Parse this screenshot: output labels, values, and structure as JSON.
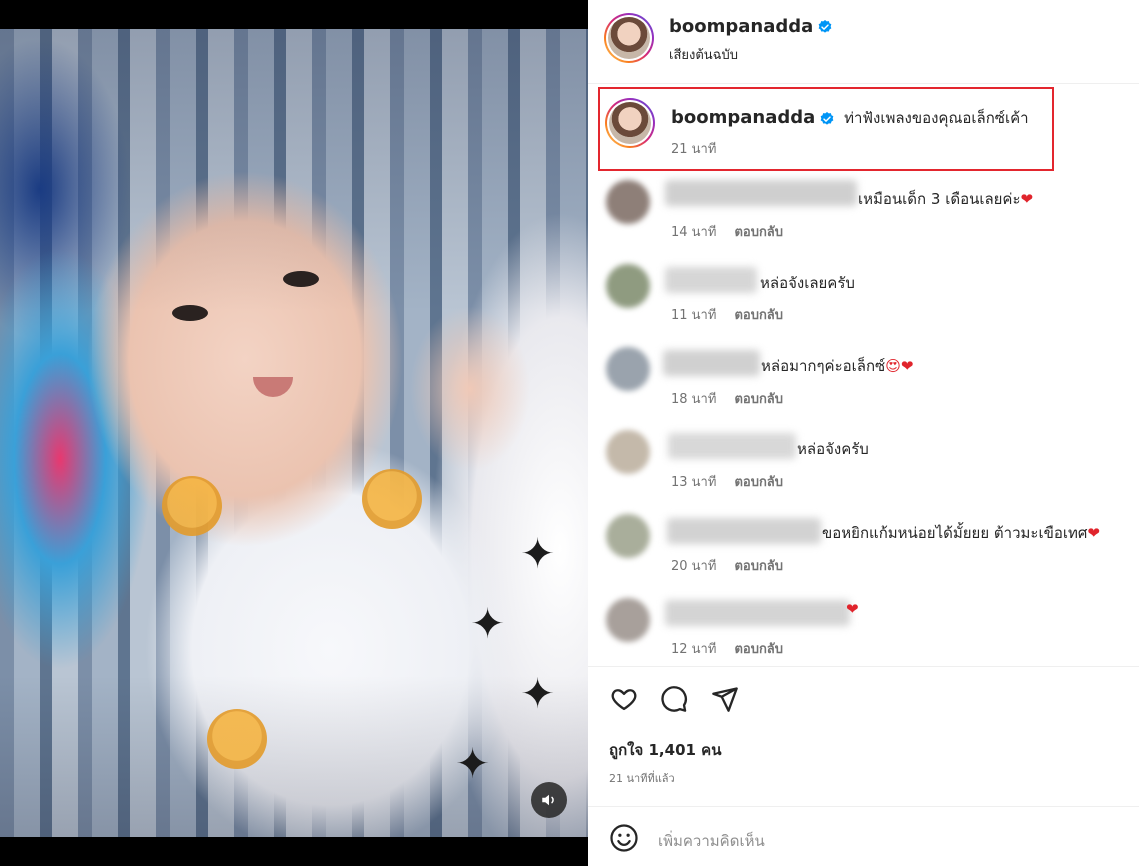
{
  "post": {
    "username": "boompanadda",
    "audio_label": "เสียงต้นฉบับ"
  },
  "caption": {
    "username": "boompanadda",
    "text": "ท่าฟังเพลงของคุณอเล็กซ์เค้า",
    "time": "21 นาที"
  },
  "comments": [
    {
      "text": "เหมือนเด็ก 3 เดือนเลยค่ะ",
      "emoji": "❤",
      "time": "14 นาที",
      "reply": "ตอบกลับ"
    },
    {
      "text": "หล่อจังเลยครับ",
      "emoji": "",
      "time": "11 นาที",
      "reply": "ตอบกลับ"
    },
    {
      "text": "หล่อมากๆค่ะอเล็กซ์",
      "emoji": "😍❤",
      "time": "18 นาที",
      "reply": "ตอบกลับ"
    },
    {
      "text": "หล่อจังครับ",
      "emoji": "",
      "time": "13 นาที",
      "reply": "ตอบกลับ"
    },
    {
      "text": "ขอหยิกแก้มหน่อยได้มั้ยยย ต้าวมะเขือเทศ",
      "emoji": "❤",
      "time": "20 นาที",
      "reply": "ตอบกลับ"
    },
    {
      "text": "",
      "emoji": "❤",
      "time": "12 นาที",
      "reply": "ตอบกลับ"
    }
  ],
  "likes_text": "ถูกใจ 1,401 คน",
  "post_time": "21 นาทีที่แล้ว",
  "add_comment_placeholder": "เพิ่มความคิดเห็น",
  "icons": {
    "like": "heart-icon",
    "comment": "comment-icon",
    "share": "send-icon",
    "emoji": "emoji-icon",
    "sound": "speaker-icon",
    "verified": "verified-badge-icon"
  },
  "colors": {
    "verified": "#0095f6",
    "highlight_border": "#e3262e",
    "meta_text": "#737373"
  }
}
